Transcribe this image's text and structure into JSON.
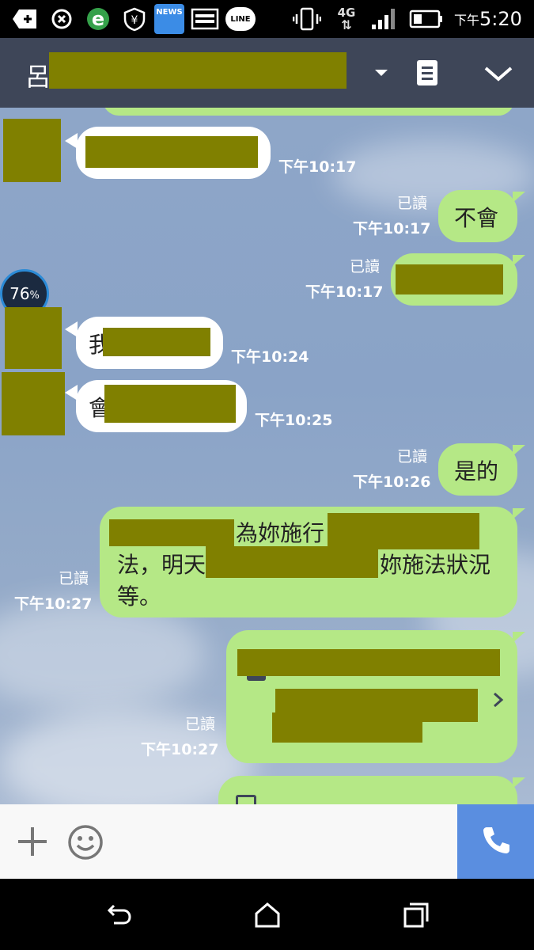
{
  "status_bar": {
    "time_prefix": "下午",
    "time": "5:20",
    "network": "4G",
    "icons": [
      "plus-icon",
      "sync-icon",
      "ie-icon",
      "shield-icon",
      "news-icon",
      "gallery-icon",
      "line-icon",
      "vibrate-icon",
      "signal-icon",
      "battery-icon"
    ],
    "news_label": "NEWS",
    "line_label": "LINE"
  },
  "header": {
    "title_initial": "呂",
    "icons": [
      "dropdown-icon",
      "notes-icon",
      "chevron-down-icon"
    ]
  },
  "chat": {
    "battery_overlay": {
      "value": "76",
      "unit": "%"
    },
    "messages": [
      {
        "dir": "in",
        "text": "",
        "time": "下午10:17"
      },
      {
        "dir": "out",
        "text": "不會",
        "read": "已讀",
        "time": "下午10:17"
      },
      {
        "dir": "out",
        "text": "",
        "read": "已讀",
        "time": "下午10:17"
      },
      {
        "dir": "in",
        "text": "我",
        "time": "下午10:24"
      },
      {
        "dir": "in",
        "text": "會",
        "time": "下午10:25"
      },
      {
        "dir": "out",
        "text": "是的",
        "read": "已讀",
        "time": "下午10:26"
      },
      {
        "dir": "out",
        "lines": [
          "為妳施行",
          "法，明天",
          "妳施法狀況",
          "等。"
        ],
        "read": "已讀",
        "time": "下午10:27"
      },
      {
        "dir": "out",
        "text": "",
        "read": "已讀",
        "time": "下午10:27"
      }
    ]
  },
  "input_bar": {
    "icons": [
      "plus-icon",
      "emoji-icon",
      "phone-icon"
    ]
  },
  "nav_bar": {
    "icons": [
      "back-icon",
      "home-icon",
      "recents-icon"
    ]
  },
  "colors": {
    "header_bg": "#3e4658",
    "incoming_bubble": "#ffffff",
    "outgoing_bubble": "#b5e886",
    "call_button": "#5a8ee0",
    "redaction": "#808000"
  }
}
